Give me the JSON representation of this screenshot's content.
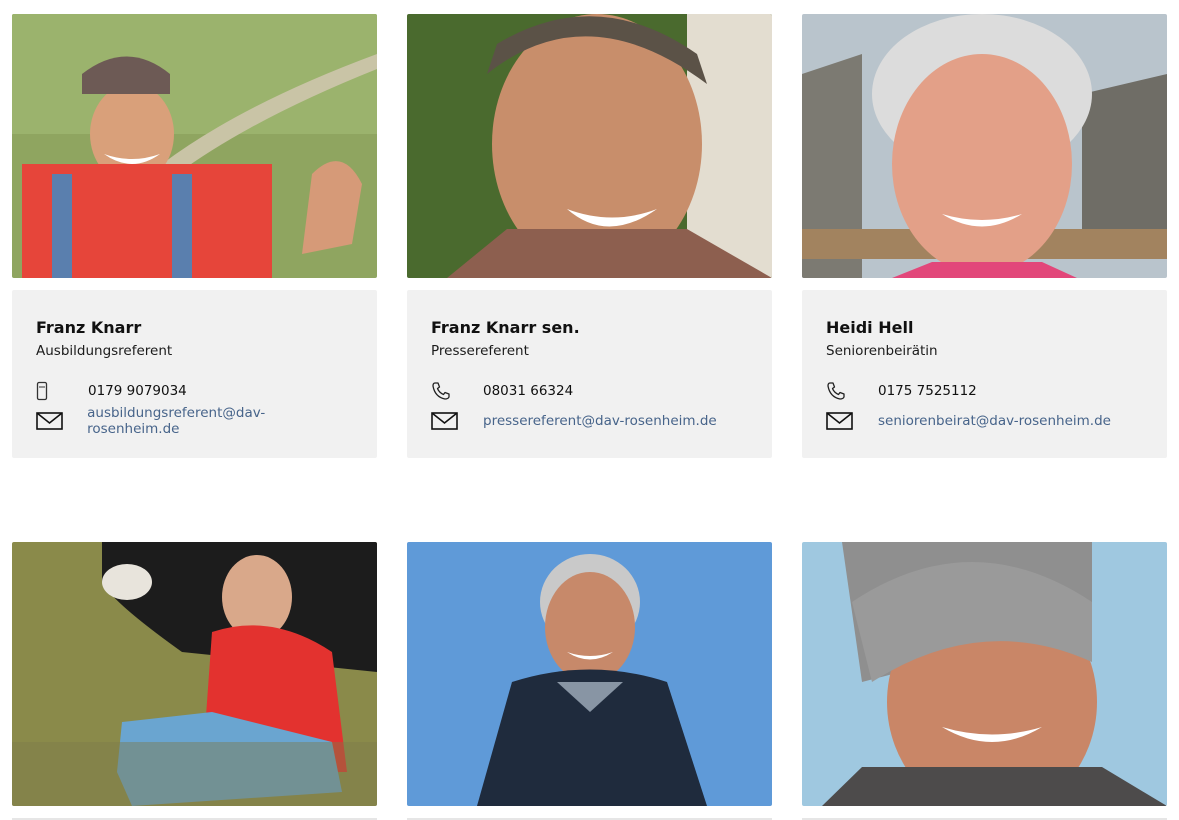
{
  "team": [
    {
      "name": "Franz Knarr",
      "role": "Ausbildungsreferent",
      "phone": "0179 9079034",
      "phone_icon": "mobile-phone-icon",
      "email": "ausbildungsreferent@dav-rosenheim.de"
    },
    {
      "name": "Franz Knarr sen.",
      "role": "Pressereferent",
      "phone": "08031 66324",
      "phone_icon": "phone-handset-icon",
      "email": "pressereferent@dav-rosenheim.de"
    },
    {
      "name": "Heidi Hell",
      "role": "Seniorenbeirätin",
      "phone": "0175 7525112",
      "phone_icon": "phone-handset-icon",
      "email": "seniorenbeirat@dav-rosenheim.de"
    }
  ],
  "colors": {
    "card_bg": "#f1f1f1",
    "link": "#47648a",
    "text": "#111111"
  }
}
